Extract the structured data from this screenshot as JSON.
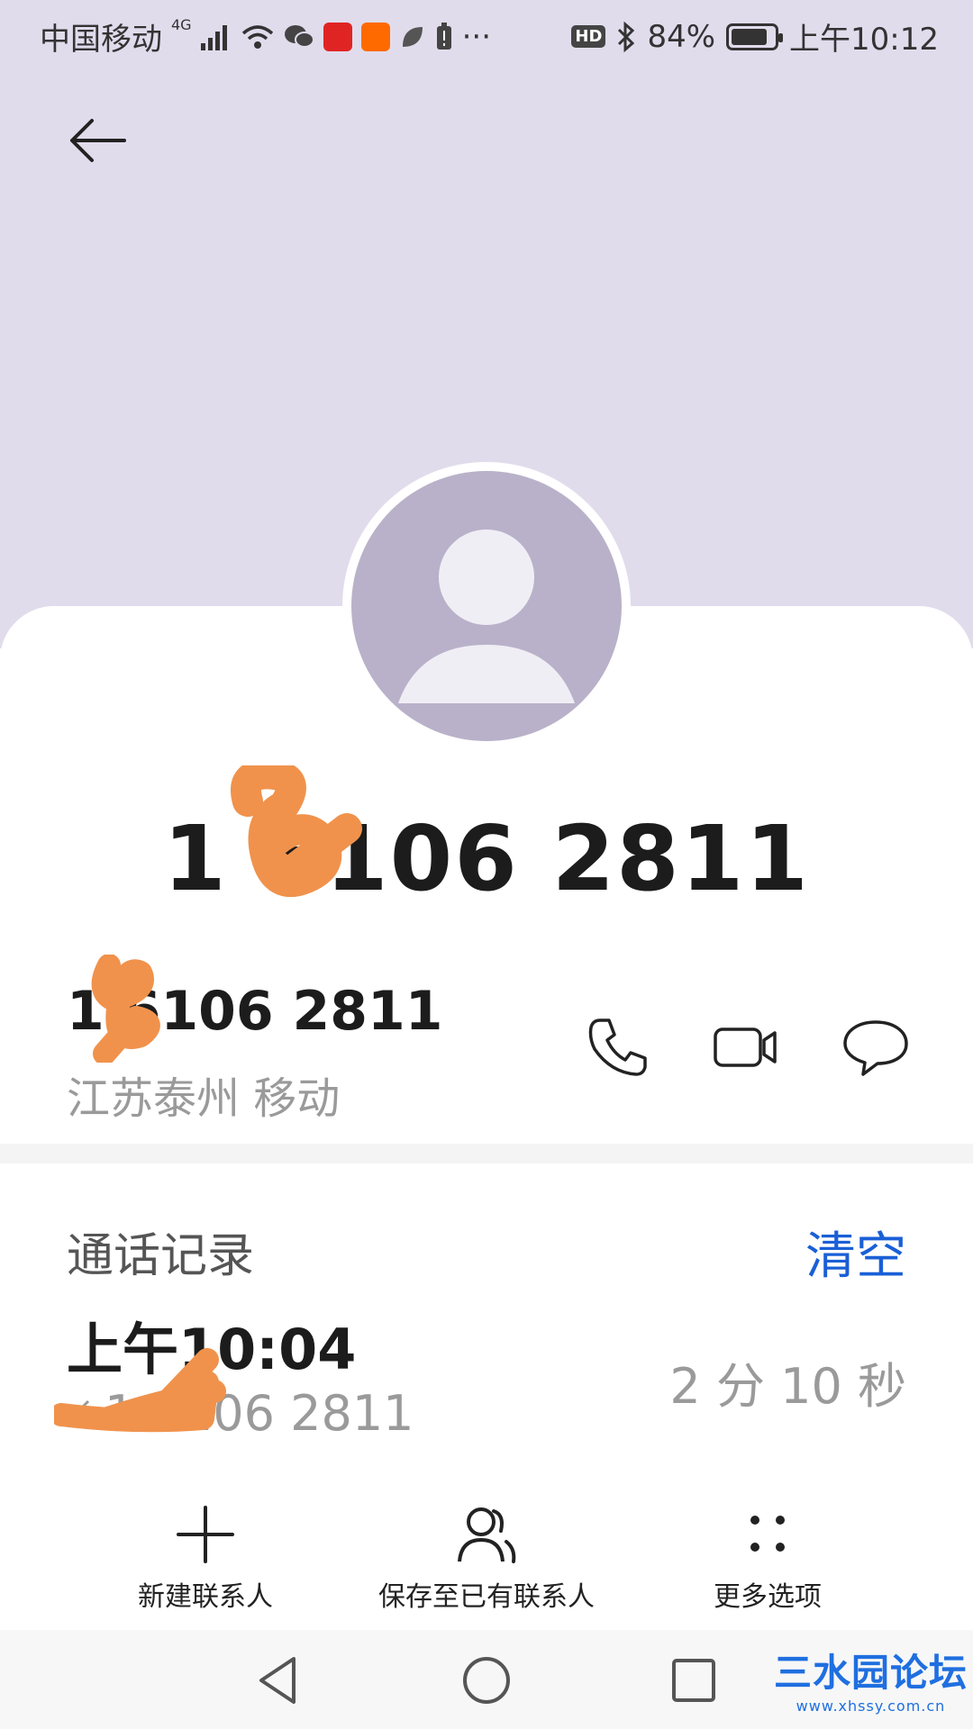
{
  "status_bar": {
    "carrier": "中国移动",
    "network": "4G",
    "more": "···",
    "hd": "HD",
    "battery_percent": "84%",
    "battery_level": 0.84,
    "time": "上午10:12"
  },
  "header": {
    "back_icon": "arrow-left-icon",
    "background_color": "#e1dcec"
  },
  "contact": {
    "display_number": "1   6106 2811",
    "number_row": "1   6106 2811",
    "location": "江苏泰州 移动",
    "actions": [
      {
        "name": "call",
        "icon": "phone-icon"
      },
      {
        "name": "video-call",
        "icon": "video-icon"
      },
      {
        "name": "message",
        "icon": "message-icon"
      }
    ]
  },
  "call_log": {
    "title": "通话记录",
    "clear_label": "清空",
    "clear_color": "#1a5fd6",
    "entries": [
      {
        "time": "上午10:04",
        "number": "1   6106 2811",
        "duration": "2 分 10 秒"
      }
    ]
  },
  "bottom_actions": [
    {
      "label": "新建联系人",
      "icon": "plus-icon"
    },
    {
      "label": "保存至已有联系人",
      "icon": "person-add-icon"
    },
    {
      "label": "更多选项",
      "icon": "more-dots-icon"
    }
  ],
  "nav_bar": {
    "buttons": [
      "back-triangle-icon",
      "home-circle-icon",
      "recents-square-icon"
    ]
  },
  "watermark": {
    "title": "三水园论坛",
    "url": "www.xhssy.com.cn"
  }
}
